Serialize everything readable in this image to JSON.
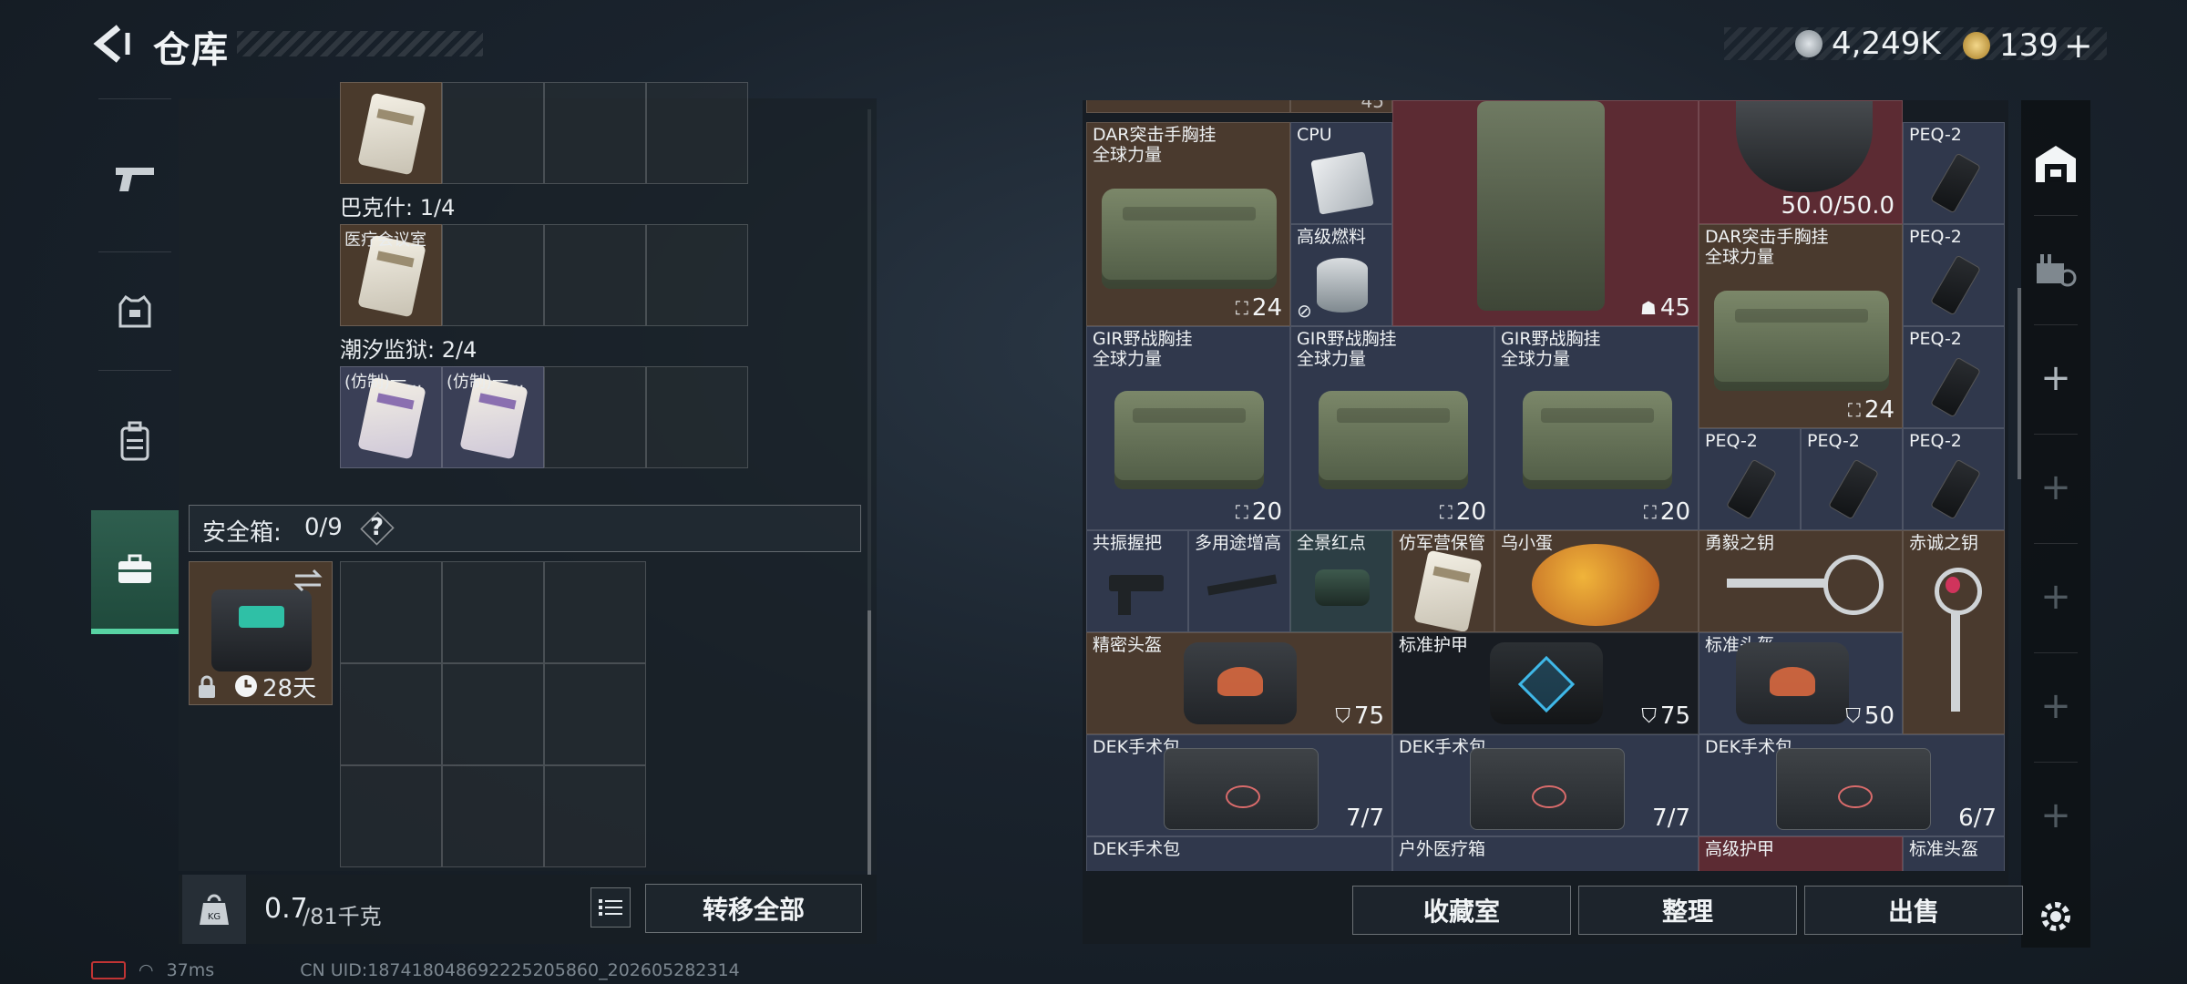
{
  "header": {
    "title": "仓库",
    "currency_silver": "4,249K",
    "currency_gold": "139",
    "gold_add": "+"
  },
  "sidenav": {
    "items": [
      {
        "name": "weapons",
        "icon": "pistol-icon"
      },
      {
        "name": "equipment",
        "icon": "armor-vest-icon"
      },
      {
        "name": "backpack",
        "icon": "backpack-icon"
      },
      {
        "name": "safe-box",
        "icon": "briefcase-icon",
        "active": true
      }
    ]
  },
  "left_panel": {
    "group_bakshi_label": "巴克什: 1/4",
    "bakshi_slot_label": "医疗会议室",
    "group_tide_label": "潮汐监狱: 2/4",
    "tide_slot_1_label": "(仿制)一...",
    "tide_slot_2_label": "(仿制)一...",
    "safe_box_label": "安全箱:",
    "safe_box_count": "0/9",
    "help": "?",
    "safe_box_timer": "28天"
  },
  "bottom_left": {
    "weight_value": "0.7",
    "weight_max": "/81千克",
    "transfer_all": "转移全部"
  },
  "grid_items": {
    "top_partial_value": "45",
    "dar1_label": "DAR突击手胸挂",
    "dar1_sub": "全球力量",
    "dar1_value": "24",
    "cpu_label": "CPU",
    "fuel_label": "高级燃料",
    "backpack_big_value": "45",
    "helmet_durability": "50.0/50.0",
    "peq_label": "PEQ-2",
    "dar2_label": "DAR突击手胸挂",
    "dar2_sub": "全球力量",
    "dar2_value": "24",
    "gir_label": "GIR野战胸挂",
    "gir_sub": "全球力量",
    "gir_value": "20",
    "grip_label": "共振握把",
    "riser_label": "多用途增高",
    "holo_label": "全景红点",
    "tube_label": "仿军营保管",
    "egg_label": "乌小蛋",
    "key1_label": "勇毅之钥",
    "key2_label": "赤诚之钥",
    "helmet1_label": "精密头盔",
    "helmet1_value": "75",
    "armor_label": "标准护甲",
    "armor_value": "75",
    "helmet2_label": "标准头盔",
    "helmet2_value": "50",
    "dek_label": "DEK手术包",
    "dek1_value": "7/7",
    "dek2_value": "7/7",
    "dek3_value": "6/7",
    "bottom_row_1": "DEK手术包",
    "bottom_row_2": "户外医疗箱",
    "bottom_row_3": "高级护甲",
    "bottom_row_4": "标准头盔"
  },
  "bottom_right": {
    "collection": "收藏室",
    "organize": "整理",
    "sell": "出售"
  },
  "status": {
    "ping": "37ms",
    "uid": "CN UID:187418048692225205860_202605282314"
  },
  "colors": {
    "accent_green": "#58d3a3",
    "cell_blue": "#30384c",
    "cell_brown": "#4a3a2e",
    "cell_red": "#5c2b33"
  }
}
